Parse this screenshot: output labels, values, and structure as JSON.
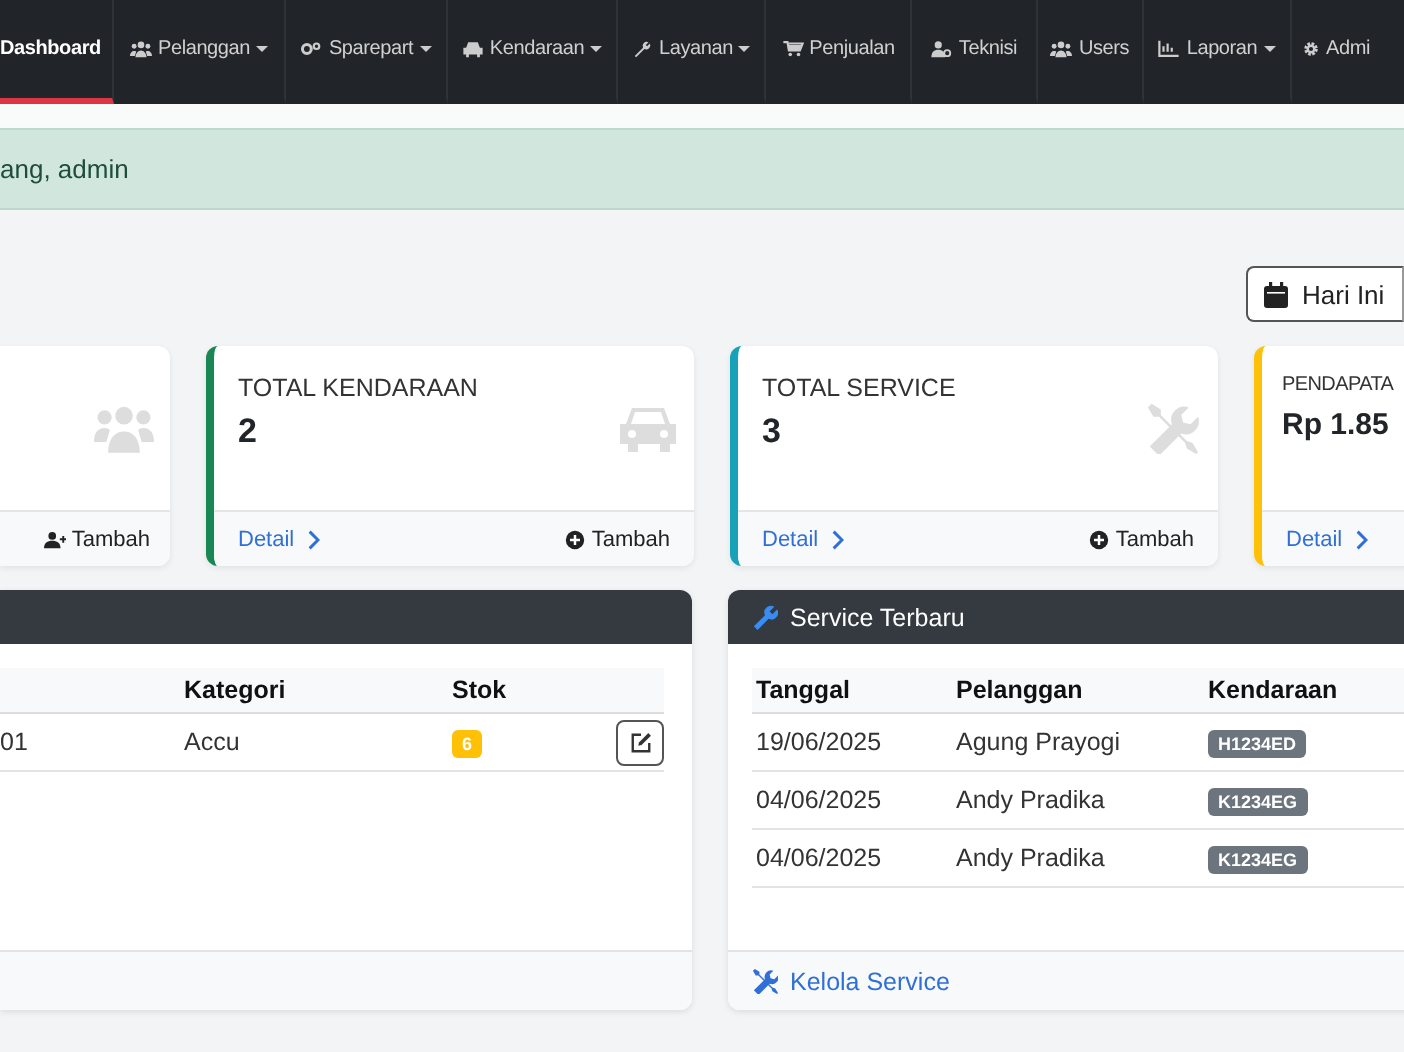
{
  "navbar": {
    "items": [
      {
        "label": "Dashboard",
        "dropdown": false,
        "selected": true
      },
      {
        "label": "Pelanggan",
        "dropdown": true,
        "selected": false
      },
      {
        "label": "Sparepart",
        "dropdown": true,
        "selected": false
      },
      {
        "label": "Kendaraan",
        "dropdown": true,
        "selected": false
      },
      {
        "label": "Layanan",
        "dropdown": true,
        "selected": false
      },
      {
        "label": "Penjualan",
        "dropdown": false,
        "selected": false
      },
      {
        "label": "Teknisi",
        "dropdown": false,
        "selected": false
      },
      {
        "label": "Users",
        "dropdown": false,
        "selected": false
      },
      {
        "label": "Laporan",
        "dropdown": true,
        "selected": false
      },
      {
        "label": "Admi",
        "dropdown": false,
        "selected": false
      }
    ]
  },
  "alert": {
    "text": "ang, admin"
  },
  "toolbar": {
    "buttons": [
      {
        "label": "Hari Ini"
      }
    ]
  },
  "cards": [
    {
      "action": "Tambah"
    },
    {
      "title": "TOTAL KENDARAAN",
      "value": "2",
      "detail": "Detail",
      "action": "Tambah",
      "color": "#198754"
    },
    {
      "title": "TOTAL SERVICE",
      "value": "3",
      "detail": "Detail",
      "action": "Tambah",
      "color": "#17a2b8"
    },
    {
      "title": "PENDAPATA",
      "value": "Rp 1.85",
      "detail": "Detail",
      "color": "#ffc107"
    }
  ],
  "sparepart_panel": {
    "columns": [
      "Kategori",
      "Stok"
    ],
    "rows": [
      {
        "column_1": "01",
        "kategori": "Accu",
        "stok": "6"
      }
    ]
  },
  "service_panel": {
    "title": "Service Terbaru",
    "columns": [
      "Tanggal",
      "Pelanggan",
      "Kendaraan"
    ],
    "rows": [
      {
        "tanggal": "19/06/2025",
        "pelanggan": "Agung Prayogi",
        "kendaraan": "H1234ED"
      },
      {
        "tanggal": "04/06/2025",
        "pelanggan": "Andy Pradika",
        "kendaraan": "K1234EG"
      },
      {
        "tanggal": "04/06/2025",
        "pelanggan": "Andy Pradika",
        "kendaraan": "K1234EG"
      }
    ],
    "footer_link": "Kelola Service"
  }
}
